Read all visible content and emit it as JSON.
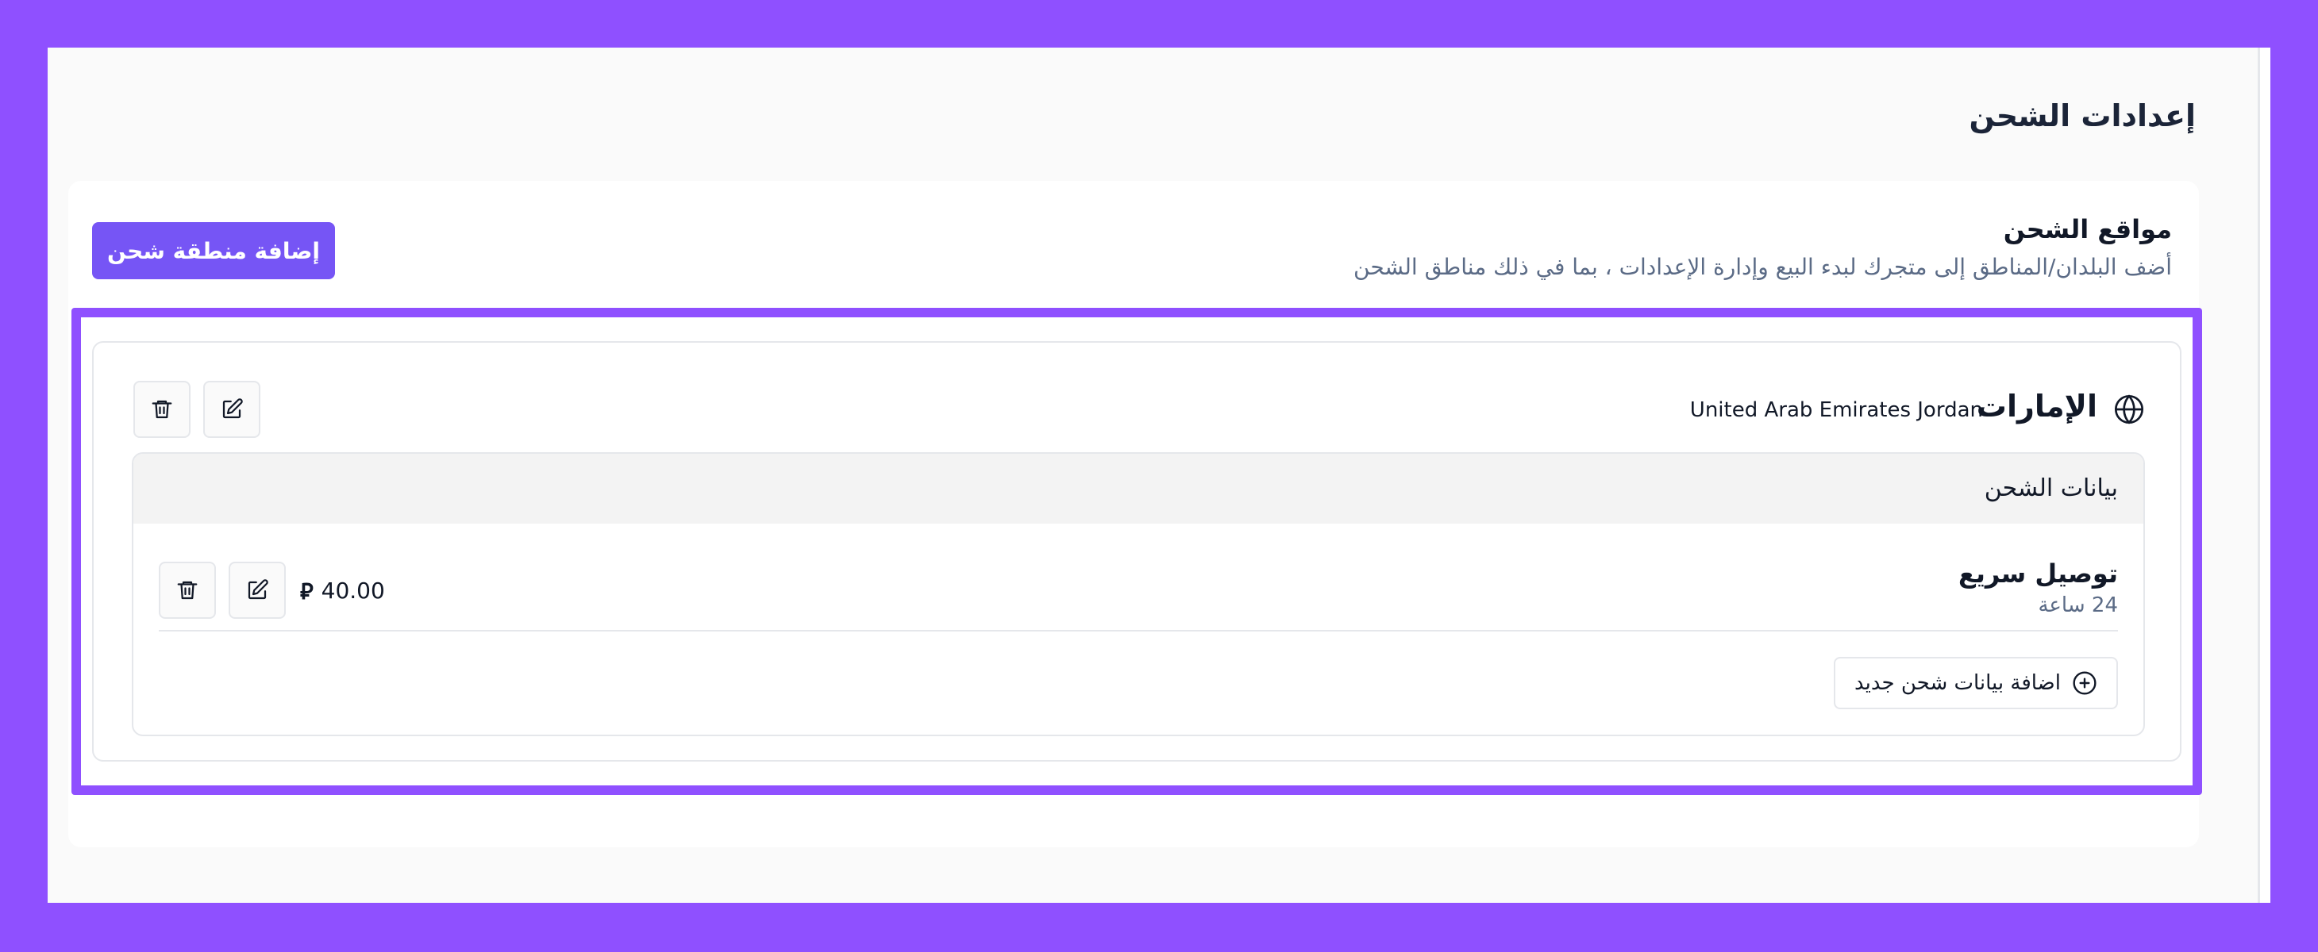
{
  "page": {
    "title": "إعدادات الشحن"
  },
  "shipping_locations": {
    "title": "مواقع الشحن",
    "subtitle": "أضف البلدان/المناطق إلى متجرك لبدء البيع وإدارة الإعدادات ، بما في ذلك مناطق الشحن",
    "add_zone_label": "إضافة منطقة شحن"
  },
  "zone": {
    "name": "الإمارات",
    "countries": "United Arab Emirates Jordan",
    "icon": "globe-icon",
    "edit_icon": "edit-icon",
    "delete_icon": "trash-icon"
  },
  "shipping_data": {
    "title": "بيانات الشحن",
    "rates": [
      {
        "name": "توصيل سريع",
        "duration": "24 ساعة",
        "price": "40.00",
        "currency_symbol": "⃁"
      }
    ],
    "add_rate_label": "اضافة بيانات شحن جديد",
    "add_rate_icon": "plus-circle-icon"
  },
  "colors": {
    "frame": "#8f50ff",
    "accent_button": "#7655f5",
    "muted_text": "#5b6b86"
  }
}
